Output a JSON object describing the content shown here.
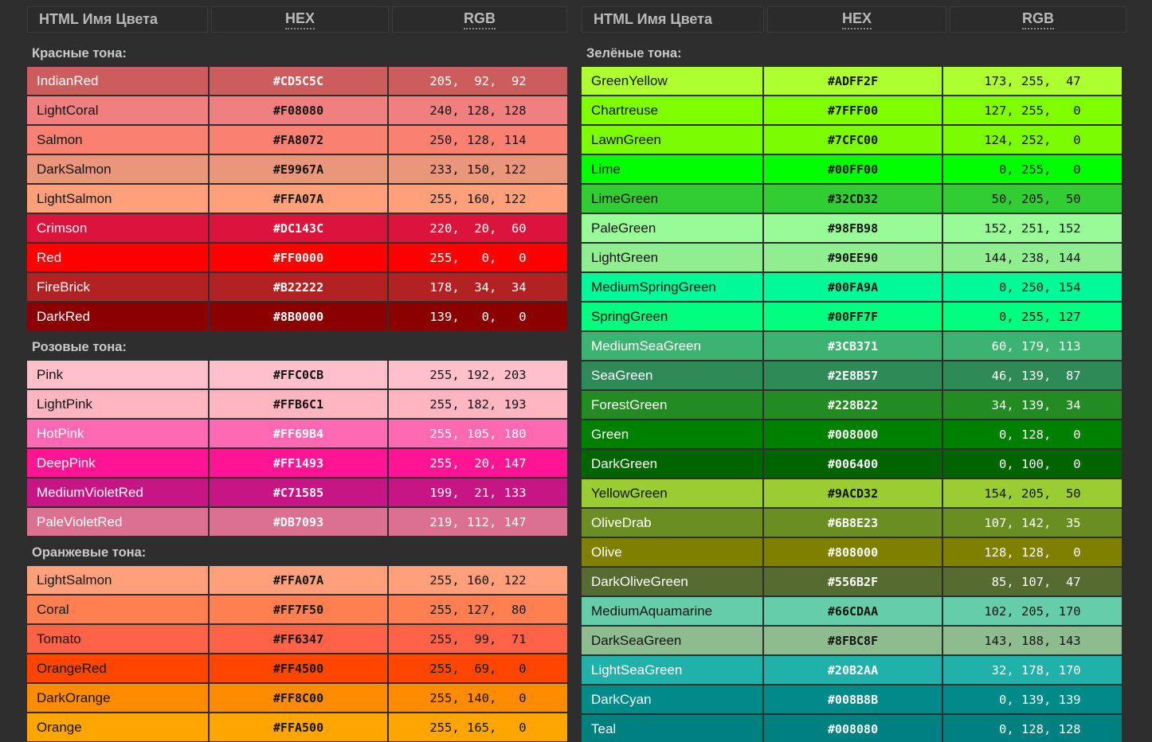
{
  "background_color": "#2e2e2e",
  "header": {
    "columns": [
      {
        "label": "HTML Имя Цвета",
        "icon": "",
        "underline": false
      },
      {
        "label": "HEX",
        "underline": true
      },
      {
        "label": "RGB",
        "underline": true
      }
    ]
  },
  "columns": [
    {
      "side": "left",
      "sections": [
        {
          "title": "Красные тона:",
          "rows": [
            {
              "name": "IndianRed",
              "hex": "#CD5C5C",
              "rgb": "205,  92,  92",
              "text": "light"
            },
            {
              "name": "LightCoral",
              "hex": "#F08080",
              "rgb": "240, 128, 128",
              "text": "dark"
            },
            {
              "name": "Salmon",
              "hex": "#FA8072",
              "rgb": "250, 128, 114",
              "text": "dark"
            },
            {
              "name": "DarkSalmon",
              "hex": "#E9967A",
              "rgb": "233, 150, 122",
              "text": "dark"
            },
            {
              "name": "LightSalmon",
              "hex": "#FFA07A",
              "rgb": "255, 160, 122",
              "text": "dark"
            },
            {
              "name": "Crimson",
              "hex": "#DC143C",
              "rgb": "220,  20,  60",
              "text": "light"
            },
            {
              "name": "Red",
              "hex": "#FF0000",
              "rgb": "255,   0,   0",
              "text": "light"
            },
            {
              "name": "FireBrick",
              "hex": "#B22222",
              "rgb": "178,  34,  34",
              "text": "light"
            },
            {
              "name": "DarkRed",
              "hex": "#8B0000",
              "rgb": "139,   0,   0",
              "text": "light"
            }
          ]
        },
        {
          "title": "Розовые тона:",
          "rows": [
            {
              "name": "Pink",
              "hex": "#FFC0CB",
              "rgb": "255, 192, 203",
              "text": "dark"
            },
            {
              "name": "LightPink",
              "hex": "#FFB6C1",
              "rgb": "255, 182, 193",
              "text": "dark"
            },
            {
              "name": "HotPink",
              "hex": "#FF69B4",
              "rgb": "255, 105, 180",
              "text": "light"
            },
            {
              "name": "DeepPink",
              "hex": "#FF1493",
              "rgb": "255,  20, 147",
              "text": "light"
            },
            {
              "name": "MediumVioletRed",
              "hex": "#C71585",
              "rgb": "199,  21, 133",
              "text": "light"
            },
            {
              "name": "PaleVioletRed",
              "hex": "#DB7093",
              "rgb": "219, 112, 147",
              "text": "light"
            }
          ]
        },
        {
          "title": "Оранжевые тона:",
          "rows": [
            {
              "name": "LightSalmon",
              "hex": "#FFA07A",
              "rgb": "255, 160, 122",
              "text": "dark"
            },
            {
              "name": "Coral",
              "hex": "#FF7F50",
              "rgb": "255, 127,  80",
              "text": "dark"
            },
            {
              "name": "Tomato",
              "hex": "#FF6347",
              "rgb": "255,  99,  71",
              "text": "dark"
            },
            {
              "name": "OrangeRed",
              "hex": "#FF4500",
              "rgb": "255,  69,   0",
              "text": "dark"
            },
            {
              "name": "DarkOrange",
              "hex": "#FF8C00",
              "rgb": "255, 140,   0",
              "text": "dark"
            },
            {
              "name": "Orange",
              "hex": "#FFA500",
              "rgb": "255, 165,   0",
              "text": "dark"
            }
          ]
        }
      ]
    },
    {
      "side": "right",
      "sections": [
        {
          "title": "Зелёные тона:",
          "rows": [
            {
              "name": "GreenYellow",
              "hex": "#ADFF2F",
              "rgb": "173, 255,  47",
              "text": "dark"
            },
            {
              "name": "Chartreuse",
              "hex": "#7FFF00",
              "rgb": "127, 255,   0",
              "text": "dark"
            },
            {
              "name": "LawnGreen",
              "hex": "#7CFC00",
              "rgb": "124, 252,   0",
              "text": "dark"
            },
            {
              "name": "Lime",
              "hex": "#00FF00",
              "rgb": "  0, 255,   0",
              "text": "dark"
            },
            {
              "name": "LimeGreen",
              "hex": "#32CD32",
              "rgb": " 50, 205,  50",
              "text": "dark"
            },
            {
              "name": "PaleGreen",
              "hex": "#98FB98",
              "rgb": "152, 251, 152",
              "text": "dark"
            },
            {
              "name": "LightGreen",
              "hex": "#90EE90",
              "rgb": "144, 238, 144",
              "text": "dark"
            },
            {
              "name": "MediumSpringGreen",
              "hex": "#00FA9A",
              "rgb": "  0, 250, 154",
              "text": "dark"
            },
            {
              "name": "SpringGreen",
              "hex": "#00FF7F",
              "rgb": "  0, 255, 127",
              "text": "dark"
            },
            {
              "name": "MediumSeaGreen",
              "hex": "#3CB371",
              "rgb": " 60, 179, 113",
              "text": "light"
            },
            {
              "name": "SeaGreen",
              "hex": "#2E8B57",
              "rgb": " 46, 139,  87",
              "text": "light"
            },
            {
              "name": "ForestGreen",
              "hex": "#228B22",
              "rgb": " 34, 139,  34",
              "text": "light"
            },
            {
              "name": "Green",
              "hex": "#008000",
              "rgb": "  0, 128,   0",
              "text": "light"
            },
            {
              "name": "DarkGreen",
              "hex": "#006400",
              "rgb": "  0, 100,   0",
              "text": "light"
            },
            {
              "name": "YellowGreen",
              "hex": "#9ACD32",
              "rgb": "154, 205,  50",
              "text": "dark"
            },
            {
              "name": "OliveDrab",
              "hex": "#6B8E23",
              "rgb": "107, 142,  35",
              "text": "light"
            },
            {
              "name": "Olive",
              "hex": "#808000",
              "rgb": "128, 128,   0",
              "text": "light"
            },
            {
              "name": "DarkOliveGreen",
              "hex": "#556B2F",
              "rgb": " 85, 107,  47",
              "text": "light"
            },
            {
              "name": "MediumAquamarine",
              "hex": "#66CDAA",
              "rgb": "102, 205, 170",
              "text": "dark"
            },
            {
              "name": "DarkSeaGreen",
              "hex": "#8FBC8F",
              "rgb": "143, 188, 143",
              "text": "dark"
            },
            {
              "name": "LightSeaGreen",
              "hex": "#20B2AA",
              "rgb": " 32, 178, 170",
              "text": "light"
            },
            {
              "name": "DarkCyan",
              "hex": "#008B8B",
              "rgb": "  0, 139, 139",
              "text": "light"
            },
            {
              "name": "Teal",
              "hex": "#008080",
              "rgb": "  0, 128, 128",
              "text": "light"
            }
          ]
        }
      ]
    }
  ]
}
